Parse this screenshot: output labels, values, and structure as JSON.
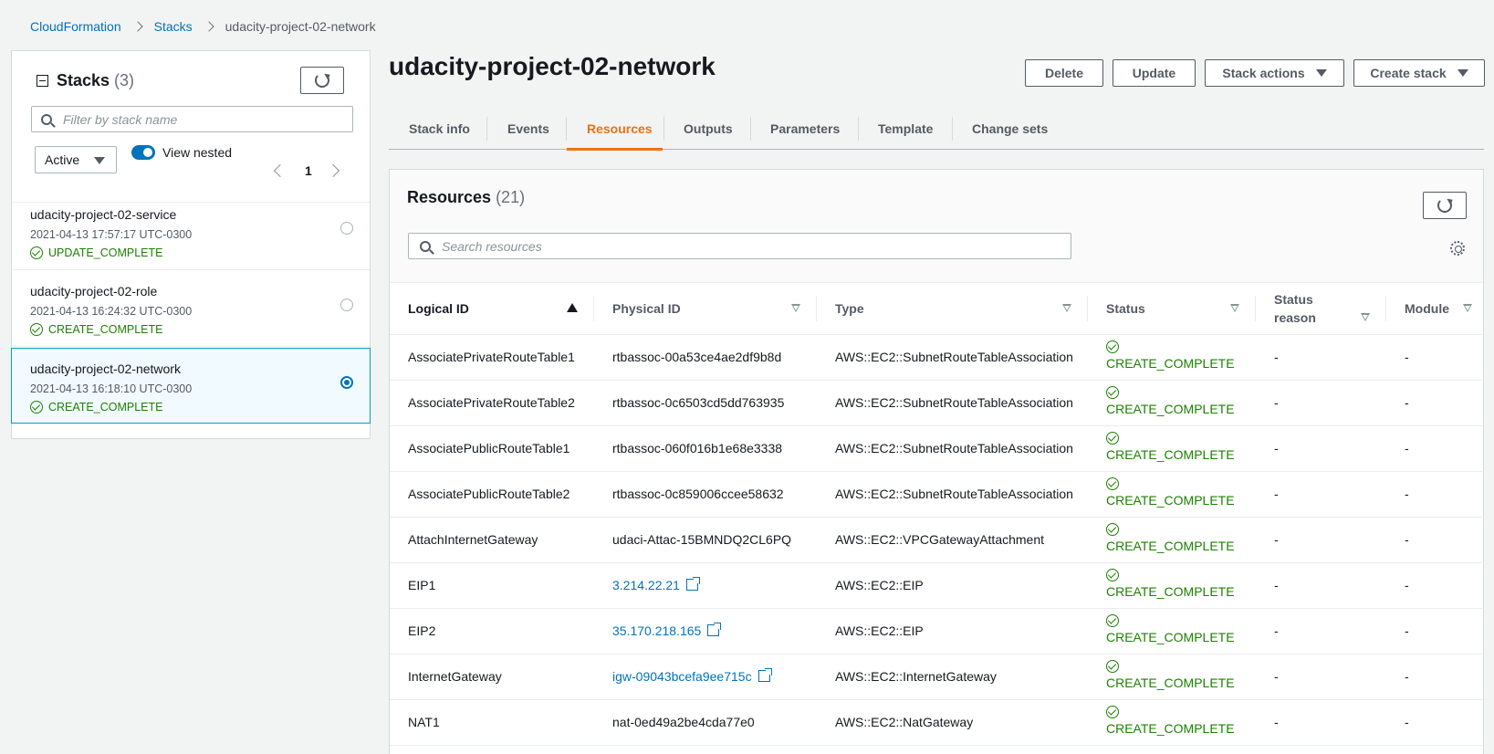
{
  "breadcrumb": {
    "root": "CloudFormation",
    "stacks": "Stacks",
    "current": "udacity-project-02-network"
  },
  "sidebar": {
    "title": "Stacks",
    "count": "(3)",
    "filter_placeholder": "Filter by stack name",
    "status_filter": "Active",
    "view_nested_label": "View nested",
    "page": "1",
    "stacks": [
      {
        "name": "udacity-project-02-service",
        "date": "2021-04-13 17:57:17 UTC-0300",
        "status": "UPDATE_COMPLETE"
      },
      {
        "name": "udacity-project-02-role",
        "date": "2021-04-13 16:24:32 UTC-0300",
        "status": "CREATE_COMPLETE"
      },
      {
        "name": "udacity-project-02-network",
        "date": "2021-04-13 16:18:10 UTC-0300",
        "status": "CREATE_COMPLETE"
      }
    ]
  },
  "header": {
    "title": "udacity-project-02-network",
    "delete_label": "Delete",
    "update_label": "Update",
    "stack_actions_label": "Stack actions",
    "create_stack_label": "Create stack"
  },
  "tabs": [
    "Stack info",
    "Events",
    "Resources",
    "Outputs",
    "Parameters",
    "Template",
    "Change sets"
  ],
  "resources": {
    "title": "Resources",
    "count": "(21)",
    "search_placeholder": "Search resources",
    "columns": [
      "Logical ID",
      "Physical ID",
      "Type",
      "Status",
      "Status reason",
      "Module"
    ],
    "rows": [
      {
        "logical": "AssociatePrivateRouteTable1",
        "physical": "rtbassoc-00a53ce4ae2df9b8d",
        "type": "AWS::EC2::SubnetRouteTableAssociation",
        "status": "CREATE_COMPLETE",
        "reason": "-",
        "module": "-"
      },
      {
        "logical": "AssociatePrivateRouteTable2",
        "physical": "rtbassoc-0c6503cd5dd763935",
        "type": "AWS::EC2::SubnetRouteTableAssociation",
        "status": "CREATE_COMPLETE",
        "reason": "-",
        "module": "-"
      },
      {
        "logical": "AssociatePublicRouteTable1",
        "physical": "rtbassoc-060f016b1e68e3338",
        "type": "AWS::EC2::SubnetRouteTableAssociation",
        "status": "CREATE_COMPLETE",
        "reason": "-",
        "module": "-"
      },
      {
        "logical": "AssociatePublicRouteTable2",
        "physical": "rtbassoc-0c859006ccee58632",
        "type": "AWS::EC2::SubnetRouteTableAssociation",
        "status": "CREATE_COMPLETE",
        "reason": "-",
        "module": "-"
      },
      {
        "logical": "AttachInternetGateway",
        "physical": "udaci-Attac-15BMNDQ2CL6PQ",
        "type": "AWS::EC2::VPCGatewayAttachment",
        "status": "CREATE_COMPLETE",
        "reason": "-",
        "module": "-"
      },
      {
        "logical": "EIP1",
        "physical": "3.214.22.21",
        "type": "AWS::EC2::EIP",
        "status": "CREATE_COMPLETE",
        "reason": "-",
        "module": "-"
      },
      {
        "logical": "EIP2",
        "physical": "35.170.218.165",
        "type": "AWS::EC2::EIP",
        "status": "CREATE_COMPLETE",
        "reason": "-",
        "module": "-"
      },
      {
        "logical": "InternetGateway",
        "physical": "igw-09043bcefa9ee715c",
        "type": "AWS::EC2::InternetGateway",
        "status": "CREATE_COMPLETE",
        "reason": "-",
        "module": "-"
      },
      {
        "logical": "NAT1",
        "physical": "nat-0ed49a2be4cda77e0",
        "type": "AWS::EC2::NatGateway",
        "status": "CREATE_COMPLETE",
        "reason": "-",
        "module": "-"
      }
    ]
  },
  "colors": {
    "link": "#0073bb",
    "success": "#1d8102",
    "active_tab": "#ec7211"
  }
}
